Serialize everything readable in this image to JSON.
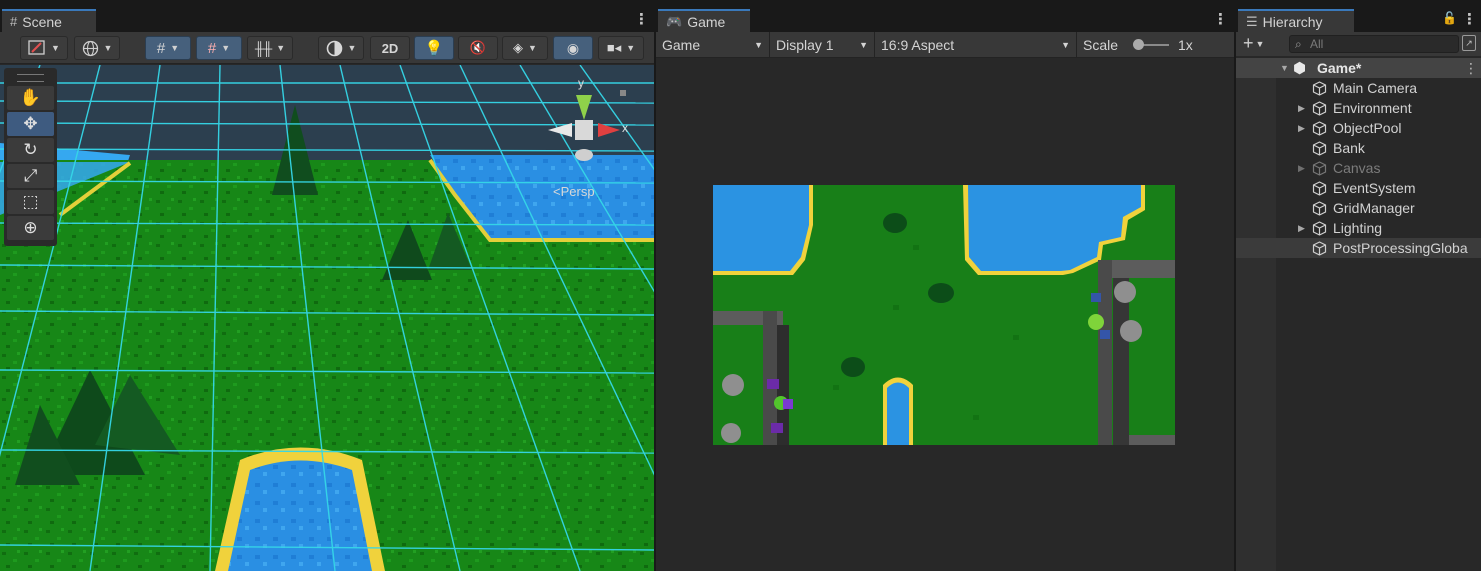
{
  "scene": {
    "tab_label": "Scene",
    "toolbar_2d": "2D",
    "persp_label": "<Persp",
    "gizmo_y": "y",
    "gizmo_x": "x"
  },
  "game": {
    "tab_label": "Game",
    "mode_select": "Game",
    "display_select": "Display 1",
    "aspect_select": "16:9 Aspect",
    "scale_label": "Scale",
    "scale_value": "1x"
  },
  "hierarchy": {
    "tab_label": "Hierarchy",
    "search_placeholder": "All",
    "root": "Game*",
    "items": [
      {
        "label": "Main Camera",
        "expandable": false
      },
      {
        "label": "Environment",
        "expandable": true
      },
      {
        "label": "ObjectPool",
        "expandable": true
      },
      {
        "label": "Bank",
        "expandable": false
      },
      {
        "label": "Canvas",
        "expandable": true,
        "inactive": true
      },
      {
        "label": "EventSystem",
        "expandable": false
      },
      {
        "label": "GridManager",
        "expandable": false
      },
      {
        "label": "Lighting",
        "expandable": true
      },
      {
        "label": "PostProcessingGloba",
        "expandable": false,
        "selected": true
      }
    ]
  },
  "colors": {
    "accent": "#3a79bb",
    "grass": "#1f8a1f",
    "water": "#2f9ee0",
    "grid": "#35d7e8"
  }
}
